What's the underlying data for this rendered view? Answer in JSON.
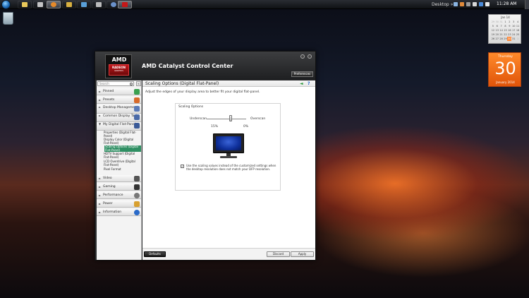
{
  "taskbar": {
    "desktop_label": "Desktop",
    "time": "11:28 AM"
  },
  "calendar": {
    "month_header": "Jan 14",
    "days": [
      "29",
      "30",
      "31",
      "1",
      "2",
      "3",
      "4",
      "5",
      "6",
      "7",
      "8",
      "9",
      "10",
      "11",
      "12",
      "13",
      "14",
      "15",
      "16",
      "17",
      "18",
      "19",
      "20",
      "21",
      "22",
      "23",
      "24",
      "25",
      "26",
      "27",
      "28",
      "29",
      "30",
      "31",
      "1"
    ],
    "weekday": "Thursday",
    "date": "30",
    "month_year": "January 2014"
  },
  "window": {
    "logo_text": "AMD",
    "badge_text": "RADEON",
    "badge_sub": "GRAPHICS",
    "title": "AMD Catalyst Control Center",
    "preferences": "Preferences"
  },
  "sidebar": {
    "search_placeholder": "Search",
    "collapse": "«",
    "items": [
      {
        "label": "Pinned"
      },
      {
        "label": "Presets"
      },
      {
        "label": "Desktop Management"
      },
      {
        "label": "Common Display Tasks"
      },
      {
        "label": "My Digital Flat-Panels"
      },
      {
        "label": "Video"
      },
      {
        "label": "Gaming"
      },
      {
        "label": "Performance"
      },
      {
        "label": "Power"
      },
      {
        "label": "Information"
      }
    ],
    "sub_items": [
      {
        "label": "Properties (Digital Flat-Panel)"
      },
      {
        "label": "Display Color (Digital Flat-Panel)"
      },
      {
        "label": "Scaling Options (Digital Flat-Panel)"
      },
      {
        "label": "HDTV Support (Digital Flat-Panel)"
      },
      {
        "label": "LCD Overdrive (Digital Flat-Panel)"
      },
      {
        "label": "Pixel Format"
      }
    ]
  },
  "content": {
    "title": "Scaling Options (Digital Flat-Panel)",
    "description": "Adjust the edges of your display area to better fit your digital flat-panel.",
    "panel_title": "Scaling Options",
    "underscan_label": "Underscan",
    "overscan_label": "Overscan",
    "underscan_value": "15%",
    "overscan_value": "0%",
    "checkbox_mark": "✓",
    "checkbox_text": "Use the scaling values instead of the customized settings when the desktop resolution does not match your DFP resolution."
  },
  "buttons": {
    "defaults": "Defaults",
    "discard": "Discard",
    "apply": "Apply"
  }
}
